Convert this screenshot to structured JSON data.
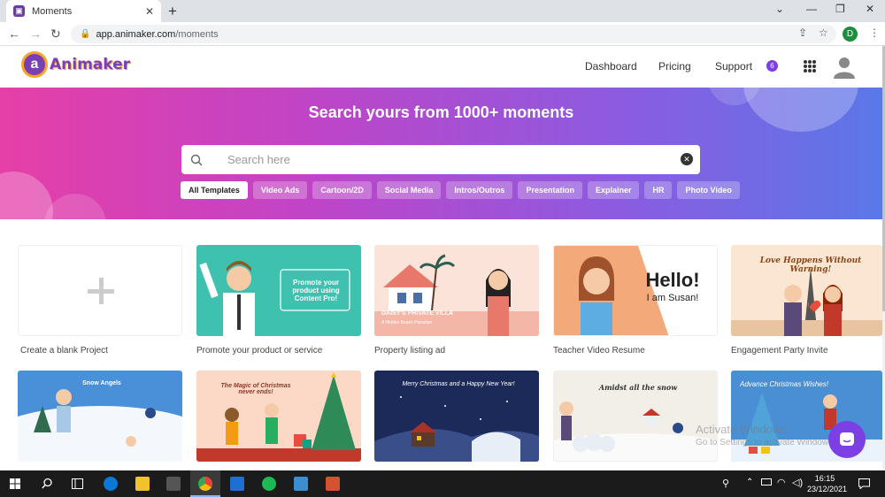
{
  "browser": {
    "tab_title": "Moments",
    "url_host": "app.animaker.com",
    "url_path": "/moments",
    "profile_initial": "D"
  },
  "site": {
    "logo_text": "Animaker",
    "nav": [
      "Dashboard",
      "Pricing",
      "Support"
    ],
    "notification_count": "6"
  },
  "hero": {
    "title": "Search yours from 1000+ moments",
    "search_placeholder": "Search here",
    "categories": [
      "All Templates",
      "Video Ads",
      "Cartoon/2D",
      "Social Media",
      "Intros/Outros",
      "Presentation",
      "Explainer",
      "HR",
      "Photo Video"
    ],
    "active_category": "All Templates"
  },
  "templates": {
    "row1": [
      {
        "label": "Create a blank Project"
      },
      {
        "label": "Promote your product or service",
        "thumb_text": "Promote your product using Content Pro!"
      },
      {
        "label": "Property listing ad",
        "thumb_text": "DAISY'S PRIVATE VILLA",
        "thumb_sub": "A Hidden Beach Paradise"
      },
      {
        "label": "Teacher Video Resume",
        "thumb_text": "Hello!",
        "thumb_sub": "I am Susan!"
      },
      {
        "label": "Engagement Party Invite",
        "thumb_text": "Love Happens Without Warning!"
      }
    ],
    "row2": [
      {
        "thumb_text": "Snow Angels"
      },
      {
        "thumb_text": "The Magic of Christmas never ends!"
      },
      {
        "thumb_text": "Merry Christmas and a Happy New Year!"
      },
      {
        "thumb_text": "Amidst all the snow"
      },
      {
        "thumb_text": "Advance Christmas Wishes!"
      }
    ]
  },
  "watermark": {
    "line1": "Activate Windows",
    "line2": "Go to Settings to activate Windows."
  },
  "taskbar": {
    "time": "16:15",
    "date": "23/12/2021"
  },
  "colors": {
    "brand": "#7a3fb5",
    "accent": "#7b3fe4",
    "hero_start": "#e63fa7",
    "hero_end": "#5a78e8"
  }
}
